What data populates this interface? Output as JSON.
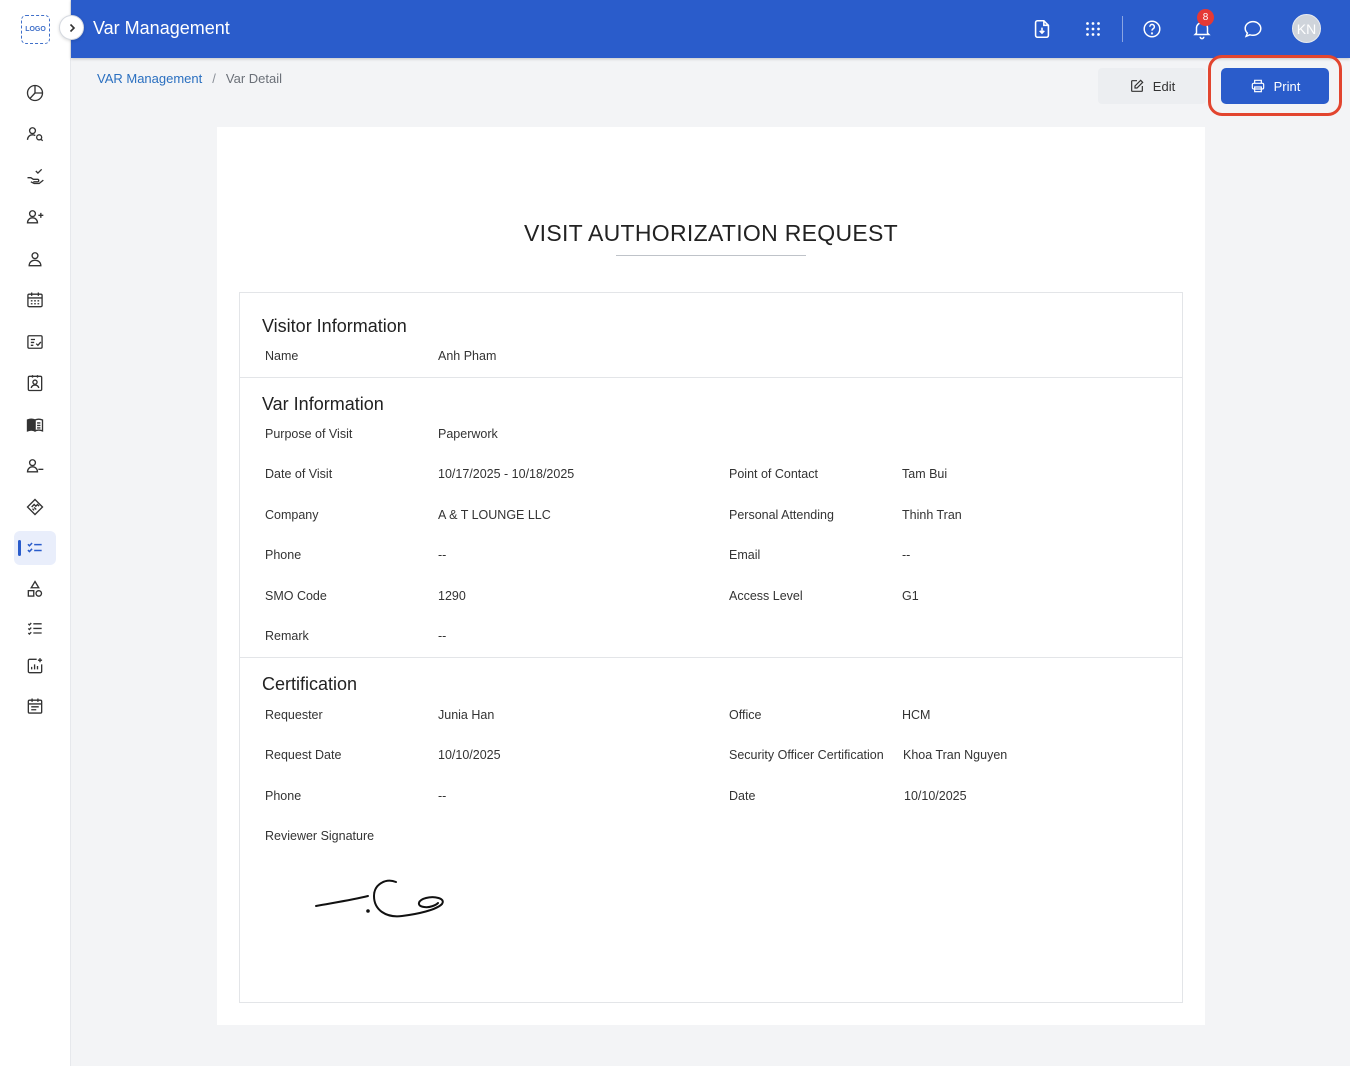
{
  "logo": {
    "text": "LOGO"
  },
  "header": {
    "title": "Var Management",
    "notification_count": "8",
    "avatar_initials": "KN"
  },
  "sidebar": {
    "items": [
      {
        "icon": "pie-chart-icon"
      },
      {
        "icon": "user-search-icon"
      },
      {
        "icon": "hand-check-icon"
      },
      {
        "icon": "user-plus-icon"
      },
      {
        "icon": "user-icon"
      },
      {
        "icon": "calendar-icon"
      },
      {
        "icon": "checklist-card-icon"
      },
      {
        "icon": "contact-card-icon"
      },
      {
        "icon": "book-icon"
      },
      {
        "icon": "user-minus-icon"
      },
      {
        "icon": "handshake-icon"
      },
      {
        "icon": "task-list-icon",
        "active": true
      },
      {
        "icon": "shapes-icon"
      },
      {
        "icon": "ordered-list-icon"
      },
      {
        "icon": "chart-add-icon"
      },
      {
        "icon": "calendar-list-icon"
      }
    ]
  },
  "breadcrumb": {
    "root": "VAR Management",
    "separator": "/",
    "current": "Var Detail"
  },
  "actions": {
    "edit_label": "Edit",
    "print_label": "Print"
  },
  "document": {
    "title": "VISIT AUTHORIZATION REQUEST",
    "visitor": {
      "heading": "Visitor Information",
      "name_label": "Name",
      "name": "Anh Pham"
    },
    "var_info": {
      "heading": "Var Information",
      "purpose_label": "Purpose of Visit",
      "purpose": "Paperwork",
      "date_label": "Date of Visit",
      "date": "10/17/2025 - 10/18/2025",
      "poc_label": "Point of Contact",
      "poc": "Tam Bui",
      "company_label": "Company",
      "company": "A & T LOUNGE LLC",
      "attending_label": "Personal Attending",
      "attending": "Thinh Tran",
      "phone_label": "Phone",
      "phone": "--",
      "email_label": "Email",
      "email": "--",
      "smo_label": "SMO Code",
      "smo": "1290",
      "access_label": "Access Level",
      "access": "G1",
      "remark_label": "Remark",
      "remark": "--"
    },
    "certification": {
      "heading": "Certification",
      "requester_label": "Requester",
      "requester": "Junia Han",
      "office_label": "Office",
      "office": "HCM",
      "request_date_label": "Request Date",
      "request_date": "10/10/2025",
      "security_label": "Security Officer Certification",
      "security": "Khoa Tran Nguyen",
      "phone_label": "Phone",
      "phone": "--",
      "date_label": "Date",
      "date": "10/10/2025",
      "signature_label": "Reviewer Signature"
    }
  },
  "colors": {
    "primary": "#2a5ccb",
    "highlight": "#e2452f",
    "badge": "#e53935"
  }
}
